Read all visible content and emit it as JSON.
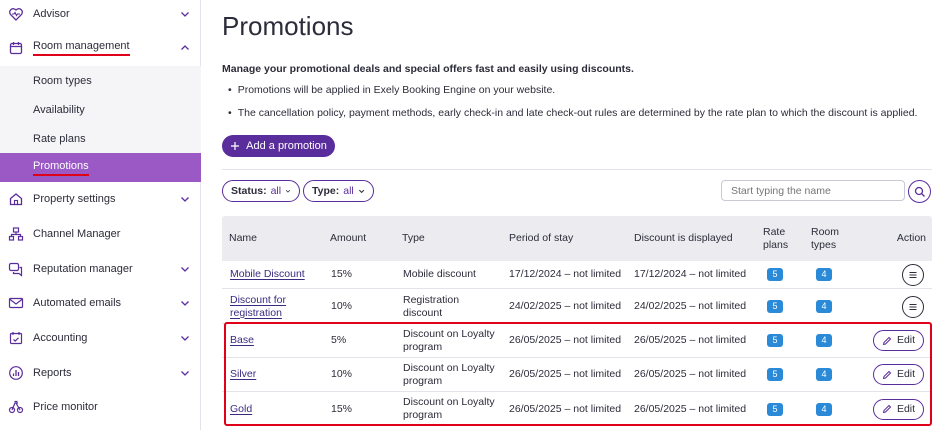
{
  "sidebar": {
    "items": [
      {
        "label": "Advisor",
        "icon": "heart-pulse-icon"
      },
      {
        "label": "Room management",
        "icon": "calendar-icon"
      },
      {
        "label": "Property settings",
        "icon": "house-icon"
      },
      {
        "label": "Channel Manager",
        "icon": "hierarchy-icon"
      },
      {
        "label": "Reputation manager",
        "icon": "chat-icon"
      },
      {
        "label": "Automated emails",
        "icon": "mail-icon"
      },
      {
        "label": "Accounting",
        "icon": "accounting-icon"
      },
      {
        "label": "Reports",
        "icon": "chart-icon"
      },
      {
        "label": "Price monitor",
        "icon": "scale-icon"
      }
    ],
    "submenu": [
      {
        "label": "Room types"
      },
      {
        "label": "Availability"
      },
      {
        "label": "Rate plans"
      },
      {
        "label": "Promotions"
      }
    ]
  },
  "main": {
    "title": "Promotions",
    "intro": "Manage your promotional deals and special offers fast and easily using discounts.",
    "bullets": [
      "Promotions will be applied in Exely Booking Engine on your website.",
      "The cancellation policy, payment methods, early check-in and late check-out rules are determined by the rate plan to which the discount is applied."
    ],
    "add_button": "Add a promotion",
    "filters": {
      "status_label": "Status:",
      "status_value": "all",
      "type_label": "Type:",
      "type_value": "all"
    },
    "search_placeholder": "Start typing the name"
  },
  "table": {
    "headers": {
      "name": "Name",
      "amount": "Amount",
      "type": "Type",
      "period": "Period of stay",
      "displayed": "Discount is displayed",
      "rate_plans_1": "Rate",
      "rate_plans_2": "plans",
      "room_types_1": "Room",
      "room_types_2": "types",
      "action": "Action"
    },
    "rows": [
      {
        "name": "Mobile Discount",
        "amount": "15%",
        "type": "Mobile discount",
        "period": "17/12/2024 – not limited",
        "displayed": "17/12/2024 – not limited",
        "rate_plans": "5",
        "room_types": "4",
        "action": "menu"
      },
      {
        "name": "Discount for registration",
        "amount": "10%",
        "type": "Registration discount",
        "period": "24/02/2025 – not limited",
        "displayed": "24/02/2025 – not limited",
        "rate_plans": "5",
        "room_types": "4",
        "action": "menu"
      },
      {
        "name": "Base",
        "amount": "5%",
        "type": "Discount on Loyalty program",
        "period": "26/05/2025 – not limited",
        "displayed": "26/05/2025 – not limited",
        "rate_plans": "5",
        "room_types": "4",
        "action": "Edit"
      },
      {
        "name": "Silver",
        "amount": "10%",
        "type": "Discount on Loyalty program",
        "period": "26/05/2025 – not limited",
        "displayed": "26/05/2025 – not limited",
        "rate_plans": "5",
        "room_types": "4",
        "action": "Edit"
      },
      {
        "name": "Gold",
        "amount": "15%",
        "type": "Discount on Loyalty program",
        "period": "26/05/2025 – not limited",
        "displayed": "26/05/2025 – not limited",
        "rate_plans": "5",
        "room_types": "4",
        "action": "Edit"
      }
    ]
  },
  "colors": {
    "accent": "#5a2d9c",
    "active_sub": "#9b59c6",
    "badge": "#2a8ad8",
    "highlight": "#e0001a"
  }
}
